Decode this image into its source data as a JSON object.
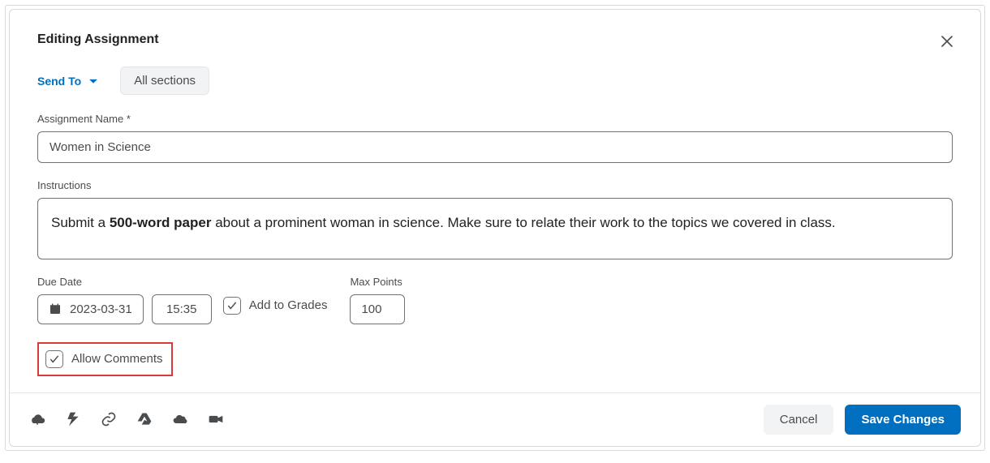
{
  "header": {
    "title": "Editing Assignment"
  },
  "sendTo": {
    "label": "Send To",
    "chip": "All sections"
  },
  "assignmentName": {
    "label": "Assignment Name *",
    "value": "Women in Science"
  },
  "instructions": {
    "label": "Instructions",
    "prefix": "Submit a ",
    "bold": "500-word paper",
    "suffix": " about a prominent woman in science. Make sure to relate their work to the topics we covered in class."
  },
  "dueDate": {
    "label": "Due Date",
    "date": "2023-03-31",
    "time": "15:35"
  },
  "addToGrades": {
    "label": "Add to Grades",
    "checked": true
  },
  "maxPoints": {
    "label": "Max Points",
    "value": "100"
  },
  "allowComments": {
    "label": "Allow Comments",
    "checked": true
  },
  "footer": {
    "cancel": "Cancel",
    "save": "Save Changes"
  }
}
